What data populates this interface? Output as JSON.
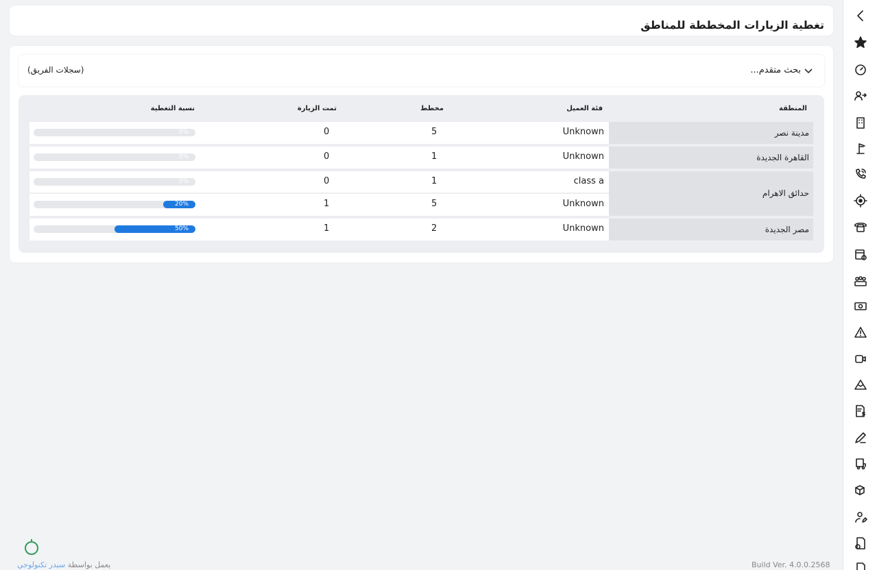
{
  "page": {
    "title": "تغطية الزيارات المخططة للمناطق"
  },
  "filters": {
    "advanced_search_label": "بحث متقدم...",
    "team_records_label": "(سجلات الفريق)"
  },
  "table": {
    "headers": {
      "region": "المنطقة",
      "customer_class": "فئة العميل",
      "planned": "مخطط",
      "visited": "تمت الزيارة",
      "coverage": "نسبة التغطية"
    },
    "rows": [
      {
        "region": "مدينة نصر",
        "customer_class": "Unknown",
        "planned": "5",
        "visited": "0",
        "coverage_label": "0%",
        "coverage": 0
      },
      {
        "region": "القاهرة الجديدة",
        "customer_class": "Unknown",
        "planned": "1",
        "visited": "0",
        "coverage_label": "0%",
        "coverage": 0
      },
      {
        "region": "حدائق الاهرام",
        "customer_class": "class a",
        "planned": "1",
        "visited": "0",
        "coverage_label": "0%",
        "coverage": 0
      },
      {
        "region": "",
        "customer_class": "Unknown",
        "planned": "5",
        "visited": "1",
        "coverage_label": "20%",
        "coverage": 0.2
      },
      {
        "region": "مصر الجديدة",
        "customer_class": "Unknown",
        "planned": "2",
        "visited": "1",
        "coverage_label": "50%",
        "coverage": 0.5
      }
    ]
  },
  "footer": {
    "build": "Build Ver. 4.0.0.2568",
    "powered_prefix": "يعمل بواسطة",
    "powered_brand": "سيدر تكنولوجي"
  },
  "colors": {
    "accent": "#1f7ae0",
    "bar_track": "#e6e7ea",
    "region_bg": "#dfe1e5",
    "timer": "#2e9e5a"
  },
  "sidebar": {
    "icons": [
      "chevron-left-icon",
      "star-icon",
      "speedometer-icon",
      "users-swap-icon",
      "building-icon",
      "crane-icon",
      "phone-signal-icon",
      "target-icon",
      "telephone-icon",
      "calendar-add-icon",
      "team-icon",
      "money-icon",
      "warning-icon",
      "video-call-icon",
      "mountain-icon",
      "invoice-dollar-icon",
      "signature-icon",
      "delivery-icon",
      "truck-box-icon",
      "user-edit-icon",
      "document-add-icon",
      "document-icon"
    ]
  }
}
